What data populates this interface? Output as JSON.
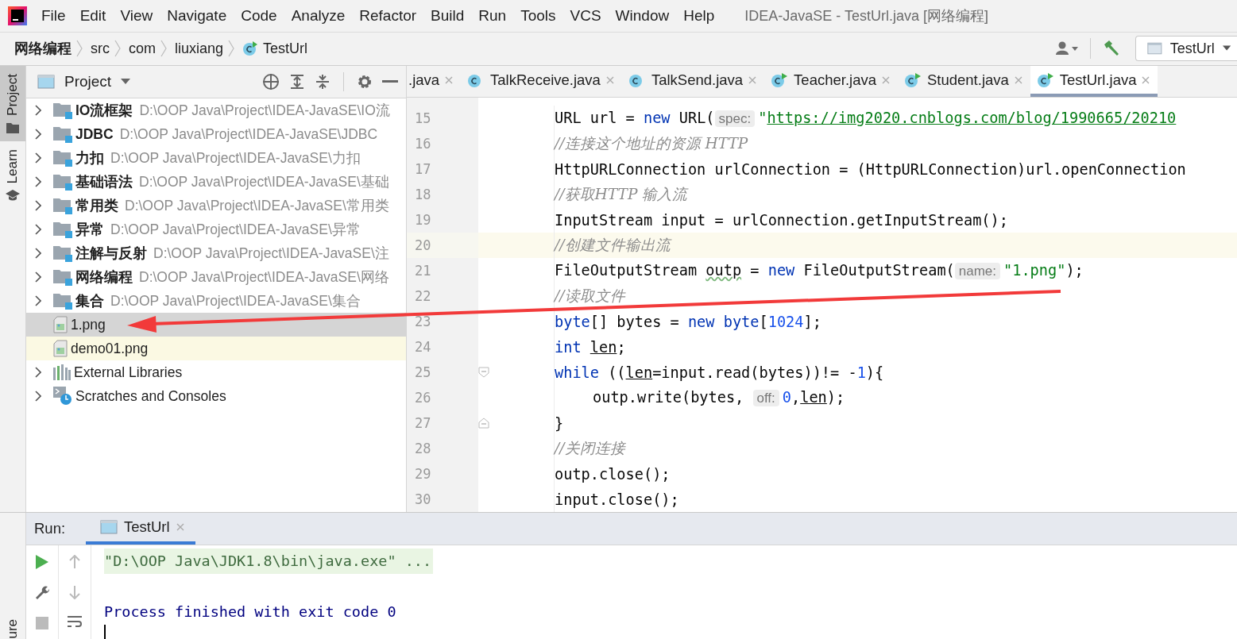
{
  "menu_bar": {
    "items": [
      {
        "label": "File"
      },
      {
        "label": "Edit"
      },
      {
        "label": "View"
      },
      {
        "label": "Navigate"
      },
      {
        "label": "Code"
      },
      {
        "label": "Analyze"
      },
      {
        "label": "Refactor"
      },
      {
        "label": "Build"
      },
      {
        "label": "Run"
      },
      {
        "label": "Tools"
      },
      {
        "label": "VCS"
      },
      {
        "label": "Window"
      },
      {
        "label": "Help"
      }
    ],
    "window_title": "IDEA-JavaSE - TestUrl.java [网络编程]"
  },
  "breadcrumb": {
    "items": [
      {
        "label": "网络编程",
        "kind": "project"
      },
      {
        "label": "src",
        "kind": "folder"
      },
      {
        "label": "com",
        "kind": "folder"
      },
      {
        "label": "liuxiang",
        "kind": "folder"
      },
      {
        "label": "TestUrl",
        "kind": "class"
      }
    ],
    "run_config": "TestUrl"
  },
  "side_strip": {
    "tabs": [
      {
        "label": "Project",
        "selected": true
      },
      {
        "label": "Learn",
        "selected": false
      }
    ],
    "bottom_tab": "ure"
  },
  "project_panel": {
    "title": "Project",
    "items": [
      {
        "kind": "module",
        "name": "IO流框架",
        "path": "D:\\OOP Java\\Project\\IDEA-JavaSE\\IO流",
        "selected": false,
        "highlighted": false
      },
      {
        "kind": "module",
        "name": "JDBC",
        "path": "D:\\OOP Java\\Project\\IDEA-JavaSE\\JDBC",
        "selected": false,
        "highlighted": false
      },
      {
        "kind": "module",
        "name": "力扣",
        "path": "D:\\OOP Java\\Project\\IDEA-JavaSE\\力扣",
        "selected": false,
        "highlighted": false
      },
      {
        "kind": "module",
        "name": "基础语法",
        "path": "D:\\OOP Java\\Project\\IDEA-JavaSE\\基础",
        "selected": false,
        "highlighted": false
      },
      {
        "kind": "module",
        "name": "常用类",
        "path": "D:\\OOP Java\\Project\\IDEA-JavaSE\\常用类",
        "selected": false,
        "highlighted": false
      },
      {
        "kind": "module",
        "name": "异常",
        "path": "D:\\OOP Java\\Project\\IDEA-JavaSE\\异常",
        "selected": false,
        "highlighted": false
      },
      {
        "kind": "module",
        "name": "注解与反射",
        "path": "D:\\OOP Java\\Project\\IDEA-JavaSE\\注",
        "selected": false,
        "highlighted": false
      },
      {
        "kind": "module",
        "name": "网络编程",
        "path": "D:\\OOP Java\\Project\\IDEA-JavaSE\\网络",
        "selected": false,
        "highlighted": false
      },
      {
        "kind": "module",
        "name": "集合",
        "path": "D:\\OOP Java\\Project\\IDEA-JavaSE\\集合",
        "selected": false,
        "highlighted": false
      },
      {
        "kind": "image",
        "name": "1.png",
        "selected": true,
        "highlighted": false
      },
      {
        "kind": "image",
        "name": "demo01.png",
        "selected": false,
        "highlighted": true
      },
      {
        "kind": "libraries",
        "name": "External Libraries",
        "selected": false,
        "highlighted": false
      },
      {
        "kind": "scratches",
        "name": "Scratches and Consoles",
        "selected": false,
        "highlighted": false
      }
    ]
  },
  "editor": {
    "tabs": [
      {
        "label": ".java",
        "selected": false
      },
      {
        "label": "TalkReceive.java",
        "selected": false,
        "runnable": false
      },
      {
        "label": "TalkSend.java",
        "selected": false,
        "runnable": false
      },
      {
        "label": "Teacher.java",
        "selected": false,
        "runnable": true
      },
      {
        "label": "Student.java",
        "selected": false,
        "runnable": true
      },
      {
        "label": "TestUrl.java",
        "selected": true,
        "runnable": true
      }
    ],
    "lines": [
      {
        "number": "15",
        "current": false,
        "tokens": [
          {
            "kind": "plain",
            "text": "URL url = "
          },
          {
            "kind": "keyword",
            "text": "new"
          },
          {
            "kind": "plain",
            "text": " URL("
          },
          {
            "kind": "hint",
            "text": "spec:"
          },
          {
            "kind": "string",
            "text": "\""
          },
          {
            "kind": "link",
            "text": "https://img2020.cnblogs.com/blog/1990665/20210"
          }
        ]
      },
      {
        "number": "16",
        "current": false,
        "tokens": [
          {
            "kind": "comment",
            "text": "//连接这个地址的资源 HTTP"
          }
        ]
      },
      {
        "number": "17",
        "current": false,
        "tokens": [
          {
            "kind": "plain",
            "text": "HttpURLConnection urlConnection = (HttpURLConnection)url.openConnection"
          }
        ]
      },
      {
        "number": "18",
        "current": false,
        "tokens": [
          {
            "kind": "comment",
            "text": "//获取HTTP 输入流"
          }
        ]
      },
      {
        "number": "19",
        "current": false,
        "tokens": [
          {
            "kind": "plain",
            "text": "InputStream input = urlConnection.getInputStream();"
          }
        ]
      },
      {
        "number": "20",
        "current": true,
        "tokens": [
          {
            "kind": "comment",
            "text": "//创建文件输出流"
          }
        ]
      },
      {
        "number": "21",
        "current": false,
        "tokens": [
          {
            "kind": "plain",
            "text": "FileOutputStream "
          },
          {
            "kind": "warning",
            "text": "outp"
          },
          {
            "kind": "plain",
            "text": " = "
          },
          {
            "kind": "keyword",
            "text": "new"
          },
          {
            "kind": "plain",
            "text": " FileOutputStream("
          },
          {
            "kind": "hint",
            "text": "name:"
          },
          {
            "kind": "string",
            "text": "\"1.png\""
          },
          {
            "kind": "plain",
            "text": ");"
          }
        ]
      },
      {
        "number": "22",
        "current": false,
        "tokens": [
          {
            "kind": "comment",
            "text": "//读取文件"
          }
        ]
      },
      {
        "number": "23",
        "current": false,
        "tokens": [
          {
            "kind": "keyword",
            "text": "byte"
          },
          {
            "kind": "plain",
            "text": "[] bytes = "
          },
          {
            "kind": "keyword",
            "text": "new byte"
          },
          {
            "kind": "plain",
            "text": "["
          },
          {
            "kind": "number",
            "text": "1024"
          },
          {
            "kind": "plain",
            "text": "];"
          }
        ]
      },
      {
        "number": "24",
        "current": false,
        "tokens": [
          {
            "kind": "keyword",
            "text": "int "
          },
          {
            "kind": "variable",
            "text": "len"
          },
          {
            "kind": "plain",
            "text": ";"
          }
        ]
      },
      {
        "number": "25",
        "current": false,
        "tokens": [
          {
            "kind": "keyword",
            "text": "while"
          },
          {
            "kind": "plain",
            "text": " (("
          },
          {
            "kind": "variable",
            "text": "len"
          },
          {
            "kind": "plain",
            "text": "=input.read(bytes))!= -"
          },
          {
            "kind": "number",
            "text": "1"
          },
          {
            "kind": "plain",
            "text": "){"
          }
        ],
        "children": [
          {
            "number": "26",
            "current": false,
            "tokens": [
              {
                "kind": "plain",
                "text": "outp.write(bytes, "
              },
              {
                "kind": "hint",
                "text": "off:"
              },
              {
                "kind": "number",
                "text": "0"
              },
              {
                "kind": "plain",
                "text": ","
              },
              {
                "kind": "variable",
                "text": "len"
              },
              {
                "kind": "plain",
                "text": ");"
              }
            ]
          }
        ]
      },
      {
        "number": "27",
        "current": false,
        "tokens": [
          {
            "kind": "plain",
            "text": "}"
          }
        ]
      },
      {
        "number": "28",
        "current": false,
        "tokens": [
          {
            "kind": "comment",
            "text": "//关闭连接"
          }
        ]
      },
      {
        "number": "29",
        "current": false,
        "tokens": [
          {
            "kind": "plain",
            "text": "outp.close();"
          }
        ]
      },
      {
        "number": "30",
        "current": false,
        "tokens": [
          {
            "kind": "plain",
            "text": "input.close();"
          }
        ]
      }
    ]
  },
  "run_panel": {
    "label": "Run:",
    "tabs": [
      {
        "label": "TestUrl",
        "selected": true
      }
    ],
    "output": [
      {
        "kind": "command",
        "text": "\"D:\\OOP Java\\JDK1.8\\bin\\java.exe\" ..."
      },
      {
        "kind": "system",
        "text": "Process finished with exit code 0"
      }
    ]
  }
}
